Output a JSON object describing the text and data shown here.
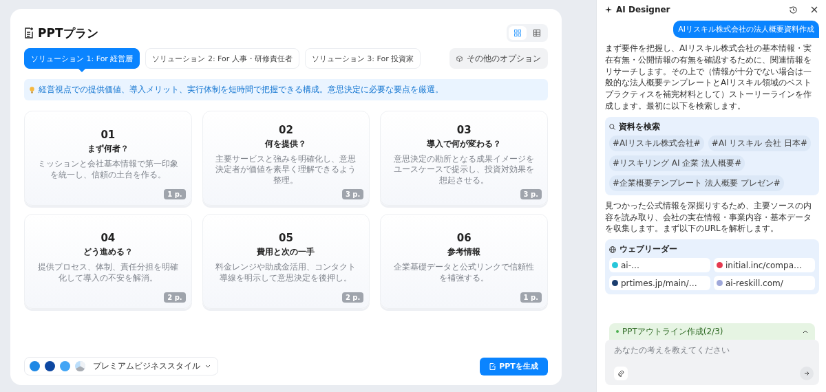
{
  "plan": {
    "title": "PPTプラン",
    "view_toggle": [
      {
        "kind": "grid",
        "selected": true
      },
      {
        "kind": "table",
        "selected": false
      }
    ],
    "tabs": [
      {
        "label": "ソリューション 1: For 経営層",
        "selected": true
      },
      {
        "label": "ソリューション 2: For 人事・研修責任者",
        "selected": false
      },
      {
        "label": "ソリューション 3: For 投資家",
        "selected": false
      }
    ],
    "options_button": "その他のオプション",
    "hint": "経営視点での提供価値、導入メリット、実行体制を短時間で把握できる構成。意思決定に必要な要点を厳選。",
    "cards": [
      {
        "number": "01",
        "title": "まず何者？",
        "description": "ミッションと会社基本情報で第一印象を統一し、信頼の土台を作る。",
        "pages": "1 p."
      },
      {
        "number": "02",
        "title": "何を提供？",
        "description": "主要サービスと強みを明確化し、意思決定者が価値を素早く理解できるよう整理。",
        "pages": "3 p."
      },
      {
        "number": "03",
        "title": "導入で何が変わる？",
        "description": "意思決定の勘所となる成果イメージをユースケースで提示し、投資対効果を想起させる。",
        "pages": "3 p."
      },
      {
        "number": "04",
        "title": "どう進める？",
        "description": "提供プロセス、体制、責任分担を明確化して導入の不安を解消。",
        "pages": "2 p."
      },
      {
        "number": "05",
        "title": "費用と次の一手",
        "description": "料金レンジや助成金活用、コンタクト導線を明示して意思決定を後押し。",
        "pages": "2 p."
      },
      {
        "number": "06",
        "title": "参考情報",
        "description": "企業基礎データと公式リンクで信頼性を補強する。",
        "pages": "1 p."
      }
    ],
    "theme": {
      "swatches": [
        {
          "kind": "solid",
          "color": "#1e88e5"
        },
        {
          "kind": "solid",
          "color": "#0d47a1"
        },
        {
          "kind": "solid",
          "color": "#42a5f5"
        },
        {
          "kind": "pie",
          "color": "#bbdefb"
        }
      ],
      "name": "プレミアムビジネススタイル"
    },
    "generate_button": "PPTを生成"
  },
  "assistant": {
    "title": "AI Designer",
    "user_message": "AIリスキル株式会社の法人概要資料作成",
    "messages": [
      {
        "kind": "text",
        "text": "まず要件を把握し、AIリスキル株式会社の基本情報・実在有無・公開情報の有無を確認するために、関連情報をリサーチします。その上で（情報が十分でない場合は一般的な法人概要テンプレートとAIリスキル領域のベストプラクティスを補完材料として）ストーリーラインを作成します。最初に以下を検索します。"
      },
      {
        "kind": "search",
        "title": "資料を検索",
        "items": [
          "#AIリスキル株式会社#",
          "#AI リスキル 会社 日本#",
          "#リスキリング AI 企業 法人概要#",
          "#企業概要テンプレート 法人概要 プレゼン#"
        ]
      },
      {
        "kind": "text",
        "text": "見つかった公式情報を深掘りするため、主要ソースの内容を読み取り、会社の実在情報・事業内容・基本データを収集します。まず以下のURLを解析します。"
      },
      {
        "kind": "web",
        "title": "ウェブリーダー",
        "items": [
          {
            "label": "ai-…",
            "color": "#26c6da"
          },
          {
            "label": "initial.inc/compa…",
            "color": "#e53950"
          },
          {
            "label": "prtimes.jp/main/…",
            "color": "#1a3d6e"
          },
          {
            "label": "ai-reskill.com/",
            "color": "#9fa8da"
          }
        ]
      }
    ],
    "progress": {
      "label": "PPTアウトライン作成(2/3)",
      "expanded": false
    },
    "input": {
      "placeholder": "あなたの考えを教えてください"
    }
  }
}
